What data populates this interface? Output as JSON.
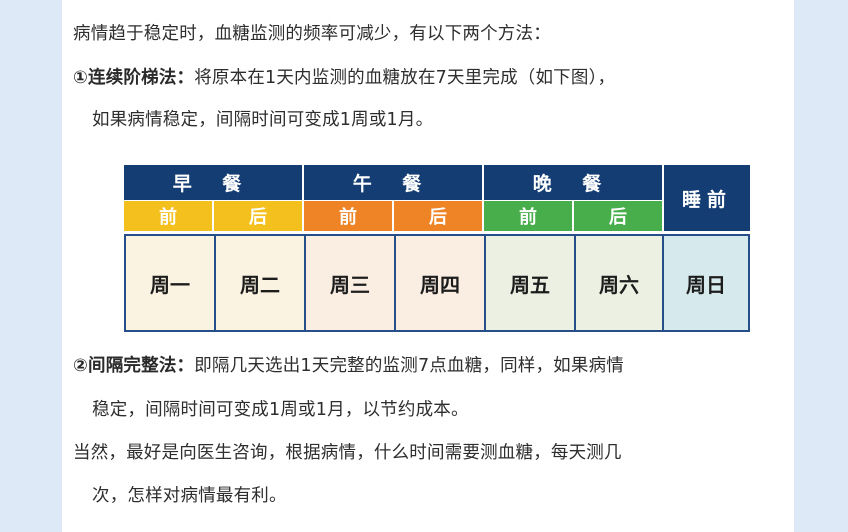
{
  "paragraph1": "病情趋于稳定时，血糖监测的频率可减少，有以下两个方法：",
  "method1": {
    "title": "①连续阶梯法：",
    "text_line1": "将原本在1天内监测的血糖放在7天里完成（如下图），",
    "text_line2": "如果病情稳定，间隔时间可变成1周或1月。"
  },
  "table": {
    "meals": [
      "早 餐",
      "午 餐",
      "晚 餐"
    ],
    "bedtime": "睡前",
    "before": "前",
    "after": "后",
    "days": [
      "周一",
      "周二",
      "周三",
      "周四",
      "周五",
      "周六",
      "周日"
    ],
    "colors": {
      "header": "#133d73",
      "breakfast": "#f4c01e",
      "lunch": "#ef8426",
      "dinner": "#48ad4b",
      "day_breakfast": "#faf3e1",
      "day_lunch": "#faeee3",
      "day_dinner": "#ebf0e2",
      "day_bedtime": "#d6e9ec"
    }
  },
  "method2": {
    "title": "②间隔完整法：",
    "text_line1": "即隔几天选出1天完整的监测7点血糖，同样，如果病情",
    "text_line2": "稳定，间隔时间可变成1周或1月，以节约成本。"
  },
  "paragraph3": {
    "line1": "当然，最好是向医生咨询，根据病情，什么时间需要测血糖，每天测几",
    "line2": "次，怎样对病情最有利。"
  }
}
